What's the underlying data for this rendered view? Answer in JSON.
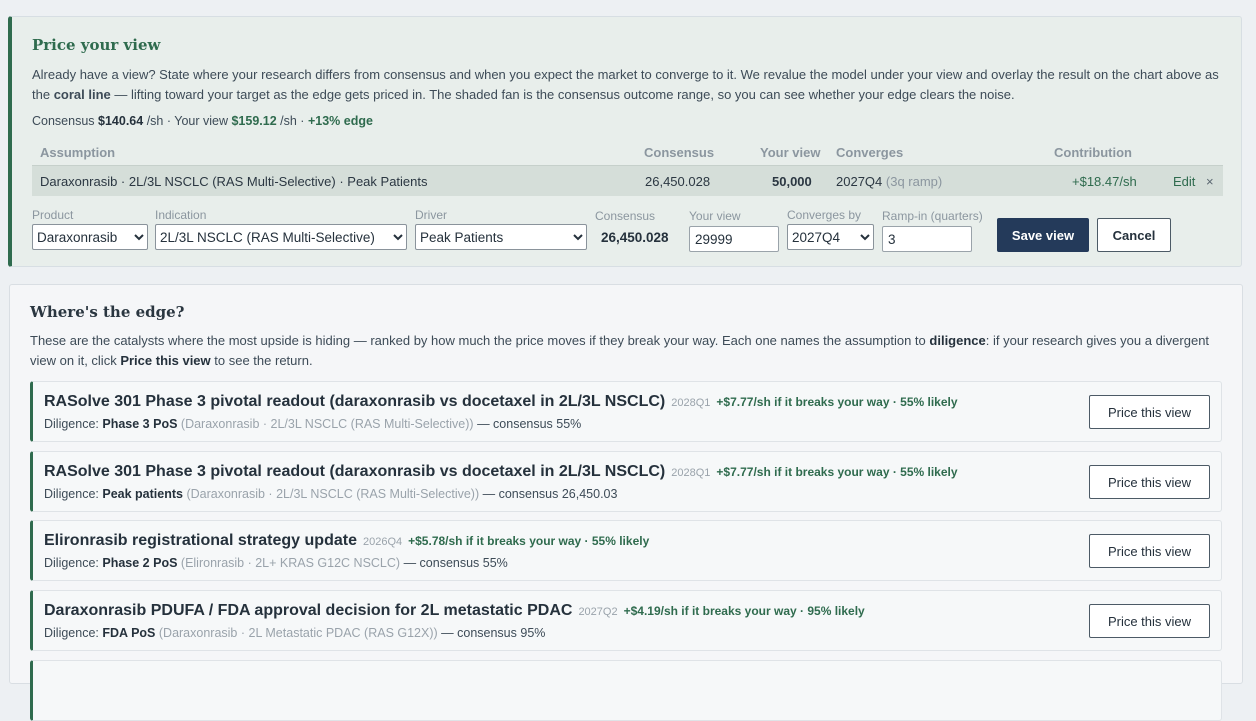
{
  "price_view": {
    "title": "Price your view",
    "desc_1": "Already have a view? State where your research differs from consensus and when you expect the market to converge to it. We revalue the model under your view and overlay the result on the chart above as the",
    "desc_bold": "coral line",
    "desc_2": "— lifting toward your target as the edge gets priced in. The shaded fan is the consensus outcome range, so you can see whether your edge clears the noise.",
    "summary": {
      "consensus_label": "Consensus",
      "consensus_value": "$140.64",
      "per_sh_1": "/sh · Your view",
      "your_view_value": "$159.12",
      "per_sh_2": "/sh ·",
      "edge": "+13% edge"
    },
    "table": {
      "headers": {
        "assumption": "Assumption",
        "consensus": "Consensus",
        "your_view": "Your view",
        "converges": "Converges",
        "contribution": "Contribution"
      },
      "row": {
        "assumption": "Daraxonrasib · 2L/3L NSCLC (RAS Multi-Selective) · Peak Patients",
        "consensus": "26,450.028",
        "your_view": "50,000",
        "converges": "2027Q4",
        "ramp": "(3q ramp)",
        "contribution": "+$18.47/sh",
        "edit": "Edit",
        "remove": "×"
      }
    },
    "form": {
      "product_label": "Product",
      "product_value": "Daraxonrasib",
      "indication_label": "Indication",
      "indication_value": "2L/3L NSCLC (RAS Multi-Selective)",
      "driver_label": "Driver",
      "driver_value": "Peak Patients",
      "consensus_label": "Consensus",
      "consensus_value": "26,450.028",
      "your_view_label": "Your view",
      "your_view_value": "29999",
      "converges_label": "Converges by",
      "converges_value": "2027Q4",
      "ramp_label": "Ramp-in (quarters)",
      "ramp_value": "3",
      "save": "Save view",
      "cancel": "Cancel"
    }
  },
  "edge": {
    "title": "Where's the edge?",
    "desc_1": "These are the catalysts where the most upside is hiding — ranked by how much the price moves if they break your way. Each one names the assumption to",
    "desc_bold_1": "diligence",
    "desc_2": ": if your research gives you a divergent view on it, click",
    "desc_bold_2": "Price this view",
    "desc_3": "to see the return.",
    "button_label": "Price this view",
    "diligence_label": "Diligence:",
    "cards": [
      {
        "name": "RASolve 301 Phase 3 pivotal readout (daraxonrasib vs docetaxel in 2L/3L NSCLC)",
        "quarter": "2028Q1",
        "upside": "+$7.77/sh if it breaks your way · 55% likely",
        "assumption": "Phase 3 PoS",
        "context": "(Daraxonrasib · 2L/3L NSCLC (RAS Multi-Selective))",
        "consensus": "— consensus 55%"
      },
      {
        "name": "RASolve 301 Phase 3 pivotal readout (daraxonrasib vs docetaxel in 2L/3L NSCLC)",
        "quarter": "2028Q1",
        "upside": "+$7.77/sh if it breaks your way · 55% likely",
        "assumption": "Peak patients",
        "context": "(Daraxonrasib · 2L/3L NSCLC (RAS Multi-Selective))",
        "consensus": "— consensus 26,450.03"
      },
      {
        "name": "Elironrasib registrational strategy update",
        "quarter": "2026Q4",
        "upside": "+$5.78/sh if it breaks your way · 55% likely",
        "assumption": "Phase 2 PoS",
        "context": "(Elironrasib · 2L+ KRAS G12C NSCLC)",
        "consensus": "— consensus 55%"
      },
      {
        "name": "Daraxonrasib PDUFA / FDA approval decision for 2L metastatic PDAC",
        "quarter": "2027Q2",
        "upside": "+$4.19/sh if it breaks your way · 95% likely",
        "assumption": "FDA PoS",
        "context": "(Daraxonrasib · 2L Metastatic PDAC (RAS G12X))",
        "consensus": "— consensus 95%"
      }
    ]
  },
  "colors": {
    "accent_green": "#2f6b4e",
    "primary_button": "#243a5a"
  }
}
